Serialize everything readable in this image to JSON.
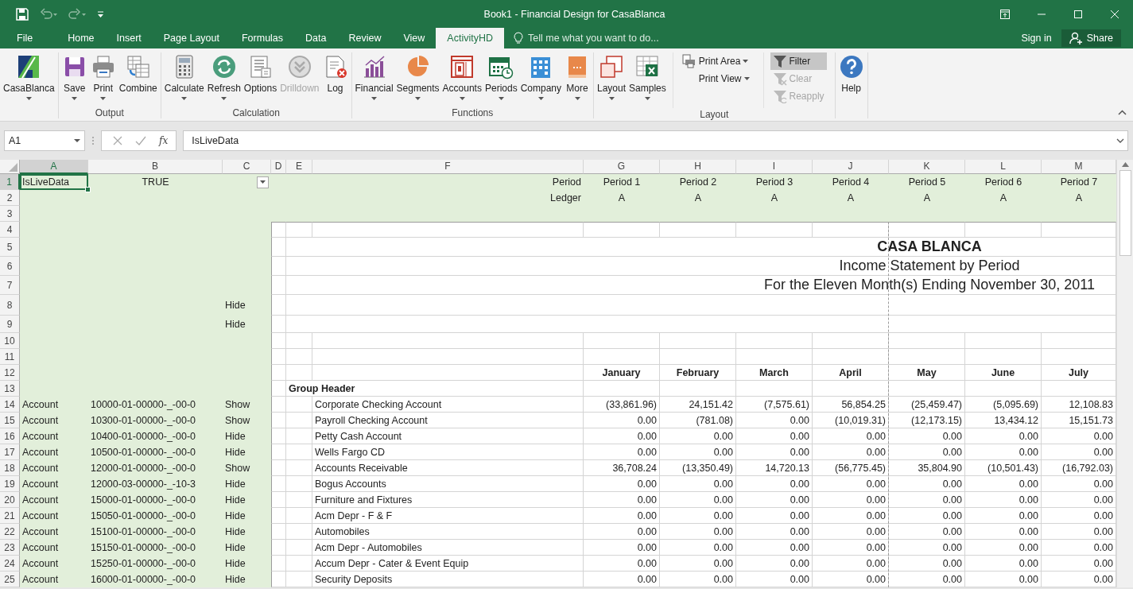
{
  "window": {
    "title": "Book1 - Financial Design for CasaBlanca"
  },
  "ribbon": {
    "tabs": [
      {
        "label": "File",
        "selected": false
      },
      {
        "label": "Home",
        "selected": false
      },
      {
        "label": "Insert",
        "selected": false
      },
      {
        "label": "Page Layout",
        "selected": false
      },
      {
        "label": "Formulas",
        "selected": false
      },
      {
        "label": "Data",
        "selected": false
      },
      {
        "label": "Review",
        "selected": false
      },
      {
        "label": "View",
        "selected": false
      },
      {
        "label": "ActivityHD",
        "selected": true
      }
    ],
    "tell_me": {
      "placeholder": "Tell me what you want to do..."
    },
    "sign_in": "Sign in",
    "share": "Share",
    "groups": [
      {
        "items": [
          {
            "kind": "large",
            "label": "CasaBlanca",
            "dropdown": true,
            "disabled": false,
            "pressed": false
          }
        ]
      },
      {
        "label": "Output",
        "items": [
          {
            "kind": "large",
            "label": "Save",
            "dropdown": true,
            "disabled": false,
            "pressed": false
          },
          {
            "kind": "large",
            "label": "Print",
            "dropdown": true,
            "disabled": false,
            "pressed": false
          },
          {
            "kind": "large",
            "label": "Combine",
            "dropdown": false,
            "disabled": false,
            "pressed": false
          }
        ]
      },
      {
        "label": "Calculation",
        "items": [
          {
            "kind": "large",
            "label": "Calculate",
            "dropdown": true,
            "disabled": false,
            "pressed": false
          },
          {
            "kind": "large",
            "label": "Refresh",
            "dropdown": true,
            "disabled": false,
            "pressed": false
          },
          {
            "kind": "large",
            "label": "Options",
            "dropdown": false,
            "disabled": false,
            "pressed": false
          },
          {
            "kind": "large",
            "label": "Drilldown",
            "dropdown": false,
            "disabled": true,
            "pressed": false
          },
          {
            "kind": "large",
            "label": "Log",
            "dropdown": false,
            "disabled": false,
            "pressed": false
          }
        ]
      },
      {
        "label": "Functions",
        "items": [
          {
            "kind": "large",
            "label": "Financial",
            "dropdown": true,
            "disabled": false,
            "pressed": false
          },
          {
            "kind": "large",
            "label": "Segments",
            "dropdown": true,
            "disabled": false,
            "pressed": false
          },
          {
            "kind": "large",
            "label": "Accounts",
            "dropdown": true,
            "disabled": false,
            "pressed": false
          },
          {
            "kind": "large",
            "label": "Periods",
            "dropdown": true,
            "disabled": false,
            "pressed": false
          },
          {
            "kind": "large",
            "label": "Company",
            "dropdown": true,
            "disabled": false,
            "pressed": false
          },
          {
            "kind": "large",
            "label": "More",
            "dropdown": true,
            "disabled": false,
            "pressed": false
          }
        ]
      },
      {
        "label": "Layout",
        "items": [
          {
            "kind": "large",
            "label": "Layout",
            "dropdown": true,
            "disabled": false,
            "pressed": false
          },
          {
            "kind": "large",
            "label": "Samples",
            "dropdown": true,
            "disabled": false,
            "pressed": false
          },
          {
            "kind": "small_column",
            "items": [
              {
                "label": "Print Area",
                "dropdown": true,
                "disabled": false,
                "pressed": false
              },
              {
                "label": "Print View",
                "dropdown": true,
                "disabled": false,
                "pressed": false
              }
            ]
          },
          {
            "kind": "small_column",
            "items": [
              {
                "label": "Filter",
                "dropdown": false,
                "disabled": false,
                "pressed": true
              },
              {
                "label": "Clear",
                "dropdown": false,
                "disabled": true,
                "pressed": false
              },
              {
                "label": "Reapply",
                "dropdown": false,
                "disabled": true,
                "pressed": false
              }
            ]
          }
        ]
      },
      {
        "items": [
          {
            "kind": "large",
            "label": "Help",
            "dropdown": false,
            "disabled": false,
            "pressed": false
          }
        ]
      }
    ]
  },
  "formula_bar": {
    "name_box": "A1",
    "insert_function": "fx",
    "value": "IsLiveData"
  },
  "sheet": {
    "columns": [
      {
        "label": "A",
        "selected": true
      },
      {
        "label": "B",
        "selected": false
      },
      {
        "label": "C",
        "selected": false
      },
      {
        "label": "D",
        "selected": false
      },
      {
        "label": "E",
        "selected": false
      },
      {
        "label": "F",
        "selected": false
      },
      {
        "label": "G",
        "selected": false
      },
      {
        "label": "H",
        "selected": false
      },
      {
        "label": "I",
        "selected": false
      },
      {
        "label": "J",
        "selected": false
      },
      {
        "label": "K",
        "selected": false
      },
      {
        "label": "L",
        "selected": false
      },
      {
        "label": "M",
        "selected": false
      }
    ],
    "rows": [
      {
        "number": "1",
        "selected": true,
        "kind": "parameters",
        "a": "IsLiveData",
        "b": "TRUE",
        "c_dropdown": true,
        "f": "Period",
        "values": [
          "Period 1",
          "Period 2",
          "Period 3",
          "Period 4",
          "Period 5",
          "Period 6",
          "Period 7"
        ]
      },
      {
        "number": "2",
        "selected": false,
        "kind": "parameters",
        "f": "Ledger",
        "values": [
          "A",
          "A",
          "A",
          "A",
          "A",
          "A",
          "A"
        ]
      },
      {
        "number": "3",
        "selected": false,
        "kind": "parameters"
      },
      {
        "number": "4",
        "selected": false,
        "kind": "blank"
      },
      {
        "number": "5",
        "selected": false,
        "kind": "heading",
        "title": "CASA BLANCA"
      },
      {
        "number": "6",
        "selected": false,
        "kind": "banner",
        "title": "Income Statement by Period"
      },
      {
        "number": "7",
        "selected": false,
        "kind": "banner",
        "title": "For the Eleven Month(s) Ending November 30, 2011"
      },
      {
        "number": "8",
        "selected": false,
        "kind": "banner",
        "c": "Hide"
      },
      {
        "number": "9",
        "selected": false,
        "kind": "banner",
        "c": "Hide"
      },
      {
        "number": "10",
        "selected": false,
        "kind": "blank"
      },
      {
        "number": "11",
        "selected": false,
        "kind": "blank"
      },
      {
        "number": "12",
        "selected": false,
        "kind": "months",
        "values": [
          "January",
          "February",
          "March",
          "April",
          "May",
          "June",
          "July"
        ]
      },
      {
        "number": "13",
        "selected": false,
        "kind": "group",
        "e": "Group Header"
      },
      {
        "number": "14",
        "selected": false,
        "kind": "account",
        "a": "Account",
        "b": "10000-01-00000-_-00-0",
        "c": "Show",
        "f": "Corporate Checking Account",
        "values": [
          "(33,861.96)",
          "24,151.42",
          "(7,575.61)",
          "56,854.25",
          "(25,459.47)",
          "(5,095.69)",
          "12,108.83"
        ]
      },
      {
        "number": "15",
        "selected": false,
        "kind": "account",
        "a": "Account",
        "b": "10300-01-00000-_-00-0",
        "c": "Show",
        "f": "Payroll Checking Account",
        "values": [
          "0.00",
          "(781.08)",
          "0.00",
          "(10,019.31)",
          "(12,173.15)",
          "13,434.12",
          "15,151.73"
        ]
      },
      {
        "number": "16",
        "selected": false,
        "kind": "account",
        "a": "Account",
        "b": "10400-01-00000-_-00-0",
        "c": "Hide",
        "f": "Petty Cash Account",
        "values": [
          "0.00",
          "0.00",
          "0.00",
          "0.00",
          "0.00",
          "0.00",
          "0.00"
        ]
      },
      {
        "number": "17",
        "selected": false,
        "kind": "account",
        "a": "Account",
        "b": "10500-01-00000-_-00-0",
        "c": "Hide",
        "f": "Wells Fargo CD",
        "values": [
          "0.00",
          "0.00",
          "0.00",
          "0.00",
          "0.00",
          "0.00",
          "0.00"
        ]
      },
      {
        "number": "18",
        "selected": false,
        "kind": "account",
        "a": "Account",
        "b": "12000-01-00000-_-00-0",
        "c": "Show",
        "f": "Accounts Receivable",
        "values": [
          "36,708.24",
          "(13,350.49)",
          "14,720.13",
          "(56,775.45)",
          "35,804.90",
          "(10,501.43)",
          "(16,792.03)"
        ]
      },
      {
        "number": "19",
        "selected": false,
        "kind": "account",
        "a": "Account",
        "b": "12000-03-00000-_-10-3",
        "c": "Hide",
        "f": "Bogus Accounts",
        "values": [
          "0.00",
          "0.00",
          "0.00",
          "0.00",
          "0.00",
          "0.00",
          "0.00"
        ]
      },
      {
        "number": "20",
        "selected": false,
        "kind": "account",
        "a": "Account",
        "b": "15000-01-00000-_-00-0",
        "c": "Hide",
        "f": "Furniture and Fixtures",
        "values": [
          "0.00",
          "0.00",
          "0.00",
          "0.00",
          "0.00",
          "0.00",
          "0.00"
        ]
      },
      {
        "number": "21",
        "selected": false,
        "kind": "account",
        "a": "Account",
        "b": "15050-01-00000-_-00-0",
        "c": "Hide",
        "f": "Acm Depr - F & F",
        "values": [
          "0.00",
          "0.00",
          "0.00",
          "0.00",
          "0.00",
          "0.00",
          "0.00"
        ]
      },
      {
        "number": "22",
        "selected": false,
        "kind": "account",
        "a": "Account",
        "b": "15100-01-00000-_-00-0",
        "c": "Hide",
        "f": "Automobiles",
        "values": [
          "0.00",
          "0.00",
          "0.00",
          "0.00",
          "0.00",
          "0.00",
          "0.00"
        ]
      },
      {
        "number": "23",
        "selected": false,
        "kind": "account",
        "a": "Account",
        "b": "15150-01-00000-_-00-0",
        "c": "Hide",
        "f": "Acm Depr - Automobiles",
        "values": [
          "0.00",
          "0.00",
          "0.00",
          "0.00",
          "0.00",
          "0.00",
          "0.00"
        ]
      },
      {
        "number": "24",
        "selected": false,
        "kind": "account",
        "a": "Account",
        "b": "15250-01-00000-_-00-0",
        "c": "Hide",
        "f": "Accum Depr - Cater & Event Equip",
        "values": [
          "0.00",
          "0.00",
          "0.00",
          "0.00",
          "0.00",
          "0.00",
          "0.00"
        ]
      },
      {
        "number": "25",
        "selected": false,
        "kind": "account",
        "a": "Account",
        "b": "16000-01-00000-_-00-0",
        "c": "Hide",
        "f": "Security Deposits",
        "values": [
          "0.00",
          "0.00",
          "0.00",
          "0.00",
          "0.00",
          "0.00",
          "0.00"
        ]
      }
    ]
  }
}
